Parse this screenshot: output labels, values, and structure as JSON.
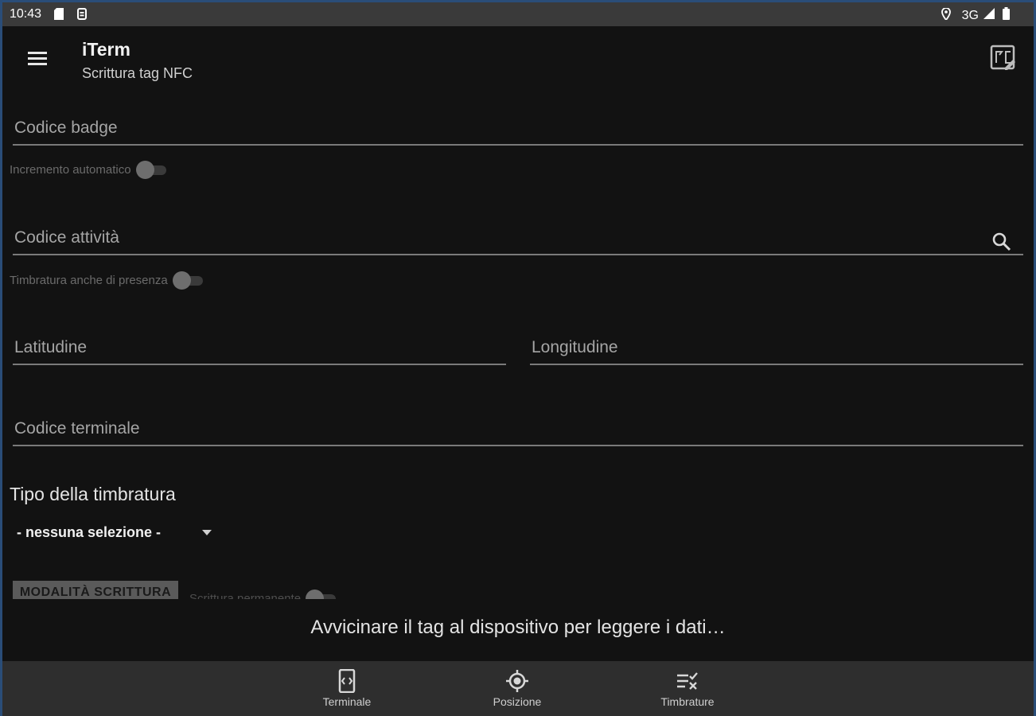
{
  "status_bar": {
    "time": "10:43",
    "network": "3G"
  },
  "app_bar": {
    "title": "iTerm",
    "subtitle": "Scrittura tag NFC"
  },
  "form": {
    "badge_code": {
      "placeholder": "Codice badge",
      "value": ""
    },
    "auto_increment": {
      "label": "Incremento automatico",
      "on": false
    },
    "activity_code": {
      "placeholder": "Codice attività",
      "value": ""
    },
    "presence_stamp": {
      "label": "Timbratura anche di presenza",
      "on": false
    },
    "latitude": {
      "placeholder": "Latitudine",
      "value": ""
    },
    "longitude": {
      "placeholder": "Longitudine",
      "value": ""
    },
    "terminal_code": {
      "placeholder": "Codice terminale",
      "value": ""
    },
    "stamp_type_title": "Tipo della timbratura",
    "stamp_type_selected": "- nessuna selezione -",
    "write_mode_button": "MODALITÀ SCRITTURA",
    "permanent_write_label": "Scrittura permanente"
  },
  "message": "Avvicinare il tag al dispositivo per leggere i dati…",
  "bottom_nav": {
    "items": [
      {
        "label": "Terminale",
        "icon": "terminal-icon"
      },
      {
        "label": "Posizione",
        "icon": "location-icon"
      },
      {
        "label": "Timbrature",
        "icon": "checklist-icon"
      }
    ]
  },
  "colors": {
    "background": "#121212",
    "status_bar": "#3a3a3a",
    "bottom_nav": "#2e2e2e",
    "text": "#e4e4e4",
    "underline": "#7a7a7a"
  }
}
